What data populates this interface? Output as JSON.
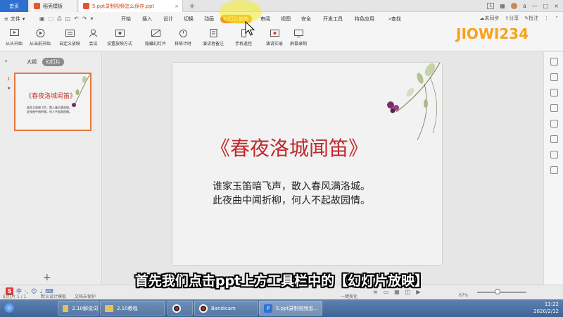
{
  "tabs": {
    "home": "首页",
    "template": "稻壳模板",
    "document": "5.ppt录制视频怎么保存.ppt",
    "add": "+"
  },
  "titlebar": {
    "page_indicator": "1",
    "user": "a"
  },
  "menu": {
    "file": "文件",
    "tabs": [
      "开始",
      "插入",
      "设计",
      "切换",
      "动画",
      "幻灯片放映",
      "审阅",
      "视图",
      "安全",
      "开发工具",
      "特色应用"
    ],
    "active_tab": "幻灯片放映",
    "search": "查找",
    "sync": "未同步",
    "share": "分享",
    "comment": "批注"
  },
  "ribbon": {
    "buttons": [
      "从头开始",
      "从当前开始",
      "自定义放映",
      "会议",
      "设置放映方式",
      "隐藏幻灯片",
      "排练计时",
      "演讲者备注",
      "手机遥控",
      "演讲实录",
      "屏幕录制"
    ]
  },
  "watermark": "JIOWI234",
  "left_panel": {
    "view_tabs": [
      "大纲",
      "幻灯片"
    ],
    "active_view": "幻灯片",
    "slide_number": "1",
    "slide_star": "★",
    "add_slide": "+"
  },
  "slide": {
    "title": "《春夜洛城闻笛》",
    "lines": [
      "谁家玉笛暗飞声，散入春风满洛城。",
      "此夜曲中闻折柳，何人不起故园情。"
    ],
    "title_color": "#c0282d"
  },
  "statusbar": {
    "slide_info": "幻灯片 1 / 1",
    "theme": "默认设计模板",
    "backup": "文档未保护",
    "beautify": "一键美化",
    "zoom": "67%"
  },
  "caption": "首先我们点击ppt上方工具栏中的【幻灯片放映】",
  "taskbar": {
    "items": [
      "2.10解说词",
      "2.10教程",
      "",
      "Bandicam",
      "5.ppt录制视频怎..."
    ],
    "active_item": "5.ppt录制视频怎...",
    "time": "13:22",
    "date": "2020/2/12"
  },
  "colors": {
    "accent_tab": "#f29c1f",
    "home_tab": "#2e6fcf",
    "highlight": "#f6ee28"
  }
}
